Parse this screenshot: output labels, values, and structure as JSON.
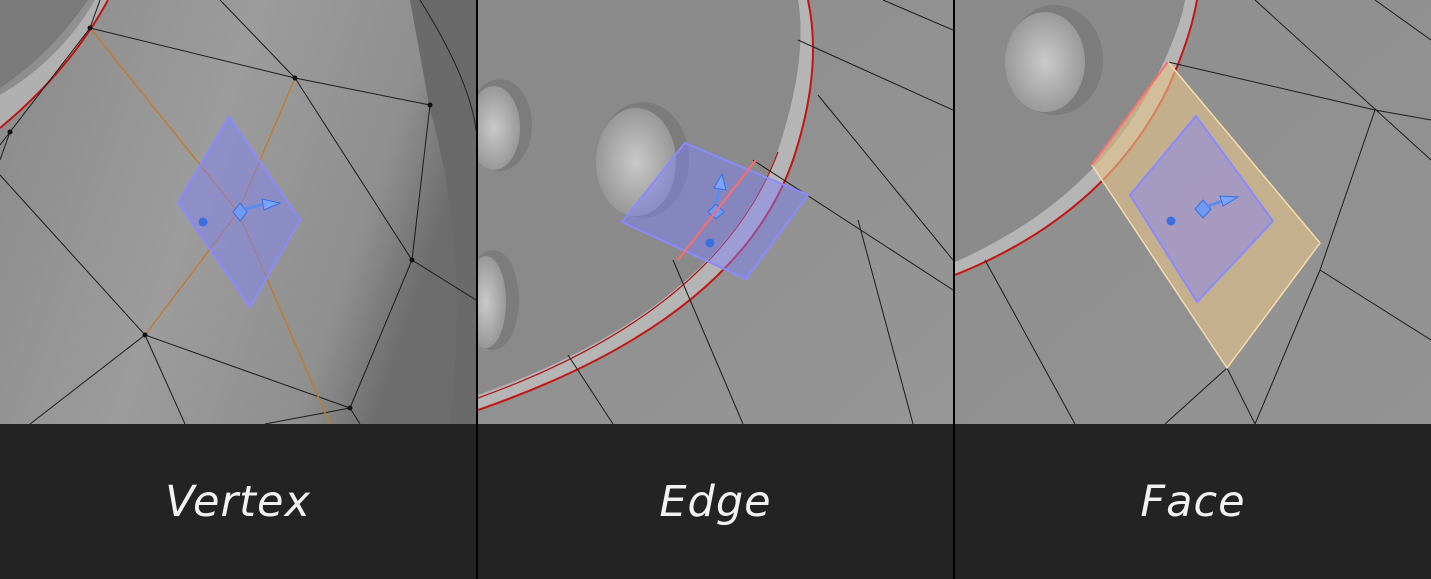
{
  "panels": [
    {
      "mode": "vertex",
      "label": "Vertex"
    },
    {
      "mode": "edge",
      "label": "Edge"
    },
    {
      "mode": "face",
      "label": "Face"
    }
  ],
  "colors": {
    "caption_bg": "#232323",
    "caption_text": "#f2f2f2",
    "gizmo_fill": "#8080ff",
    "gizmo_handle": "#5b8cf0",
    "seam_red": "#d01818",
    "face_highlight": "#e8c48a",
    "selected_vertex_edges": "#c27a2e"
  }
}
